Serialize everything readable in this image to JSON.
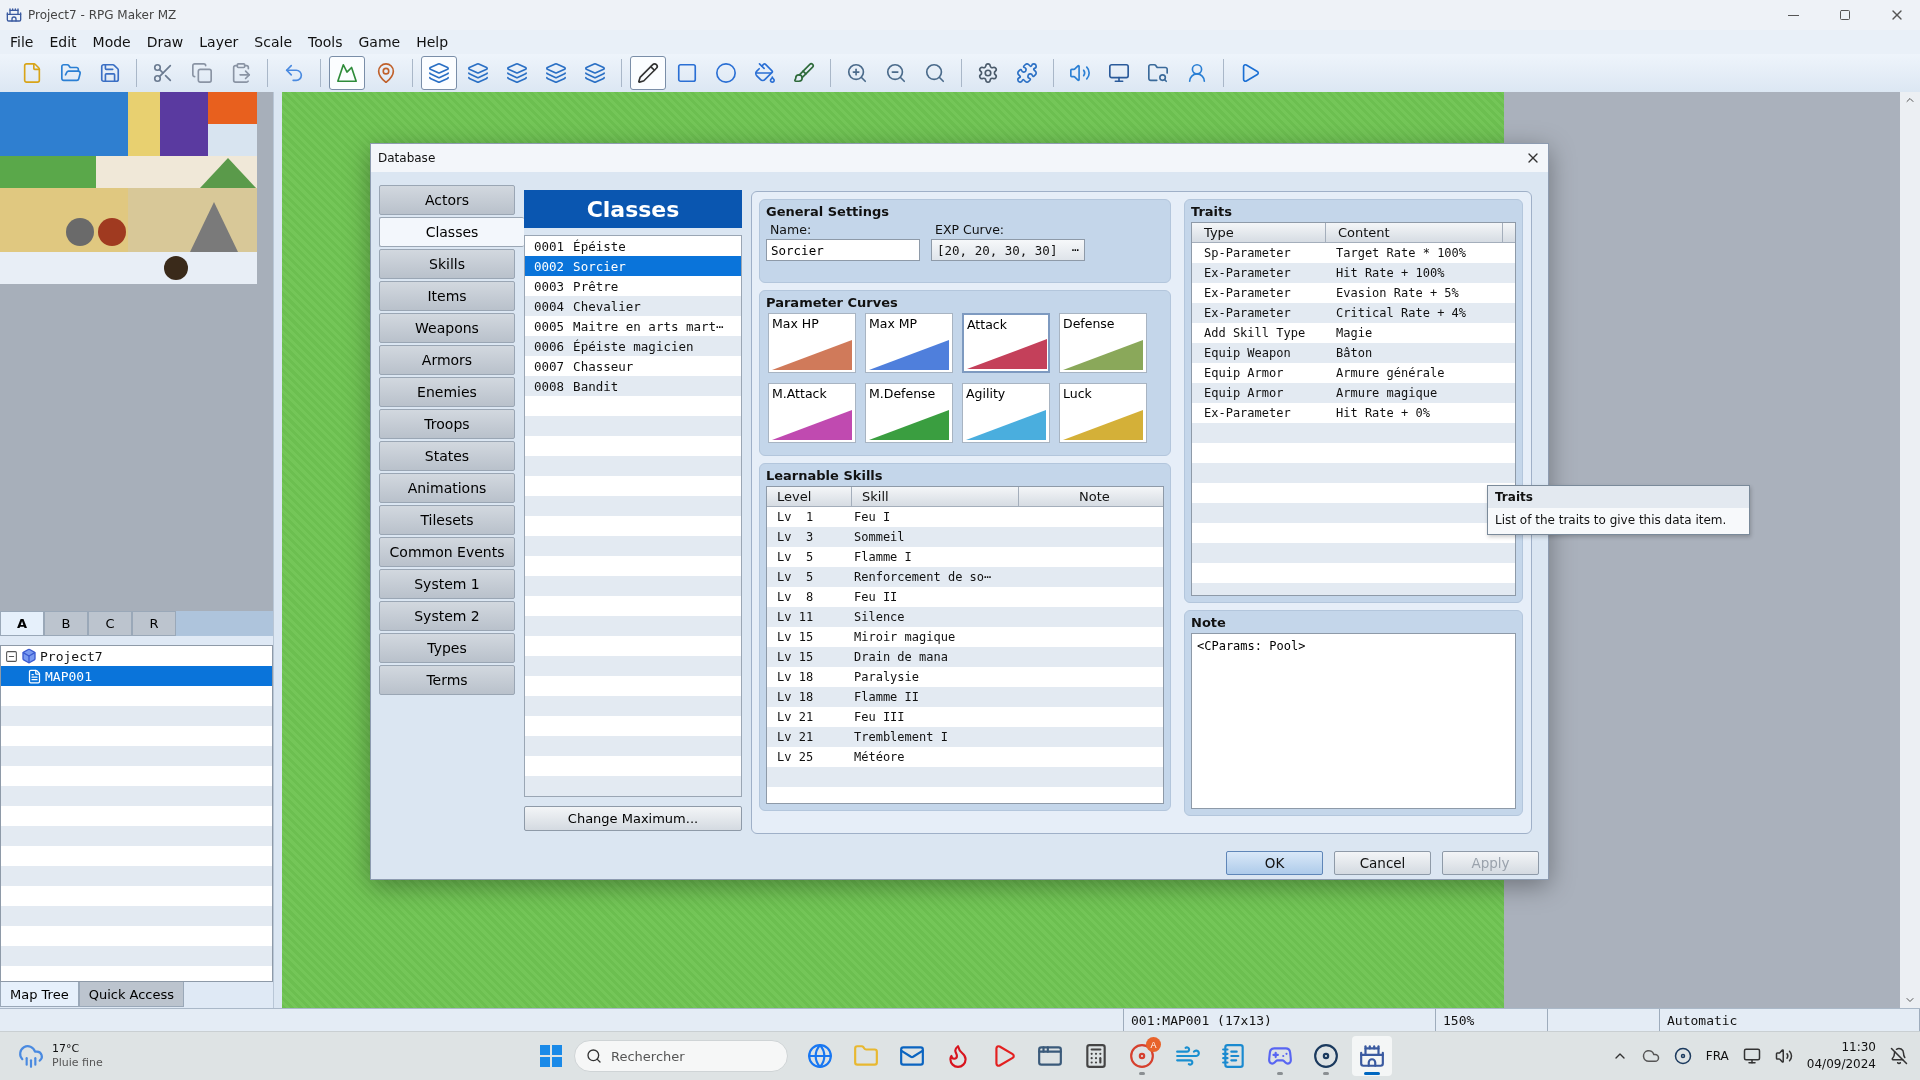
{
  "window": {
    "title": "Project7 - RPG Maker MZ"
  },
  "menu": [
    "File",
    "Edit",
    "Mode",
    "Draw",
    "Layer",
    "Scale",
    "Tools",
    "Game",
    "Help"
  ],
  "toolbar": [
    [
      {
        "kind": "new",
        "selected": false
      },
      {
        "kind": "open",
        "selected": false
      },
      {
        "kind": "save",
        "selected": false
      }
    ],
    [
      {
        "kind": "cut",
        "selected": false
      },
      {
        "kind": "copy",
        "selected": false
      },
      {
        "kind": "paste",
        "selected": false
      }
    ],
    [
      {
        "kind": "undo",
        "selected": false
      }
    ],
    [
      {
        "kind": "map",
        "selected": true
      },
      {
        "kind": "event",
        "selected": false
      }
    ],
    [
      {
        "kind": "layer",
        "selected": true
      },
      {
        "kind": "layer",
        "selected": false
      },
      {
        "kind": "layer",
        "selected": false
      },
      {
        "kind": "layer",
        "selected": false
      },
      {
        "kind": "layer",
        "selected": false
      }
    ],
    [
      {
        "kind": "pencil",
        "selected": true
      },
      {
        "kind": "rect",
        "selected": false
      },
      {
        "kind": "ellipse",
        "selected": false
      },
      {
        "kind": "fill",
        "selected": false
      },
      {
        "kind": "shadow",
        "selected": false
      }
    ],
    [
      {
        "kind": "zoomin",
        "selected": false
      },
      {
        "kind": "zoomout",
        "selected": false
      },
      {
        "kind": "zoomactual",
        "selected": false
      }
    ],
    [
      {
        "kind": "database",
        "selected": false
      },
      {
        "kind": "plugins",
        "selected": false
      }
    ],
    [
      {
        "kind": "sound",
        "selected": false
      },
      {
        "kind": "resources",
        "selected": false
      },
      {
        "kind": "search",
        "selected": false
      },
      {
        "kind": "generator",
        "selected": false
      }
    ],
    [
      {
        "kind": "playtest",
        "selected": false
      }
    ]
  ],
  "tileset": {
    "kind": "picture",
    "tabs": [
      {
        "label": "A",
        "selected": true
      },
      {
        "label": "B",
        "selected": false
      },
      {
        "label": "C",
        "selected": false
      },
      {
        "label": "R",
        "selected": false
      }
    ]
  },
  "map_tree": [
    {
      "label": "Project7",
      "selected": false,
      "expanded": true,
      "children": [
        {
          "label": "MAP001",
          "selected": true
        }
      ]
    }
  ],
  "panel_tabs": [
    {
      "label": "Map Tree",
      "selected": true
    },
    {
      "label": "Quick Access",
      "selected": false
    }
  ],
  "dialog": {
    "title": "Database",
    "categories": [
      {
        "label": "Actors",
        "selected": false
      },
      {
        "label": "Classes",
        "selected": true
      },
      {
        "label": "Skills",
        "selected": false
      },
      {
        "label": "Items",
        "selected": false
      },
      {
        "label": "Weapons",
        "selected": false
      },
      {
        "label": "Armors",
        "selected": false
      },
      {
        "label": "Enemies",
        "selected": false
      },
      {
        "label": "Troops",
        "selected": false
      },
      {
        "label": "States",
        "selected": false
      },
      {
        "label": "Animations",
        "selected": false
      },
      {
        "label": "Tilesets",
        "selected": false
      },
      {
        "label": "Common Events",
        "selected": false
      },
      {
        "label": "System 1",
        "selected": false
      },
      {
        "label": "System 2",
        "selected": false
      },
      {
        "label": "Types",
        "selected": false
      },
      {
        "label": "Terms",
        "selected": false
      }
    ],
    "list_title": "Classes",
    "items": [
      {
        "number": "0001",
        "name": "Épéiste",
        "selected": false
      },
      {
        "number": "0002",
        "name": "Sorcier",
        "selected": true
      },
      {
        "number": "0003",
        "name": "Prêtre",
        "selected": false
      },
      {
        "number": "0004",
        "name": "Chevalier",
        "selected": false
      },
      {
        "number": "0005",
        "name": "Maitre en arts mart⋯",
        "selected": false
      },
      {
        "number": "0006",
        "name": "Épéiste magicien",
        "selected": false
      },
      {
        "number": "0007",
        "name": "Chasseur",
        "selected": false
      },
      {
        "number": "0008",
        "name": "Bandit",
        "selected": false
      }
    ],
    "change_maximum": "Change Maximum...",
    "general_settings": {
      "title": "General Settings",
      "name_label": "Name:",
      "name_value": "Sorcier",
      "exp_label": "EXP Curve:",
      "exp_value": "[20, 20, 30, 30]",
      "exp_button": "⋯"
    },
    "parameter_curves": {
      "title": "Parameter Curves",
      "curves": [
        {
          "label": "Max HP",
          "color": "#d07a5a",
          "selected": false
        },
        {
          "label": "Max MP",
          "color": "#4f7fdc",
          "selected": false
        },
        {
          "label": "Attack",
          "color": "#c4405a",
          "selected": true
        },
        {
          "label": "Defense",
          "color": "#8aa85a",
          "selected": false
        },
        {
          "label": "M.Attack",
          "color": "#c04ab0",
          "selected": false
        },
        {
          "label": "M.Defense",
          "color": "#3a9e40",
          "selected": false
        },
        {
          "label": "Agility",
          "color": "#4aaede",
          "selected": false
        },
        {
          "label": "Luck",
          "color": "#d4b038",
          "selected": false
        }
      ]
    },
    "learnable_skills": {
      "title": "Learnable Skills",
      "columns": [
        "Level",
        "Skill",
        "Note"
      ],
      "rows": [
        {
          "level": "Lv  1",
          "skill": "Feu I"
        },
        {
          "level": "Lv  3",
          "skill": "Sommeil"
        },
        {
          "level": "Lv  5",
          "skill": "Flamme I"
        },
        {
          "level": "Lv  5",
          "skill": "Renforcement de so⋯"
        },
        {
          "level": "Lv  8",
          "skill": "Feu II"
        },
        {
          "level": "Lv 11",
          "skill": "Silence"
        },
        {
          "level": "Lv 15",
          "skill": "Miroir magique"
        },
        {
          "level": "Lv 15",
          "skill": "Drain de mana"
        },
        {
          "level": "Lv 18",
          "skill": "Paralysie"
        },
        {
          "level": "Lv 18",
          "skill": "Flamme II"
        },
        {
          "level": "Lv 21",
          "skill": "Feu III"
        },
        {
          "level": "Lv 21",
          "skill": "Tremblement I"
        },
        {
          "level": "Lv 25",
          "skill": "Météore"
        }
      ]
    },
    "traits": {
      "title": "Traits",
      "columns": [
        "Type",
        "Content"
      ],
      "rows": [
        {
          "type": "Sp-Parameter",
          "content": "Target Rate * 100%"
        },
        {
          "type": "Ex-Parameter",
          "content": "Hit Rate + 100%"
        },
        {
          "type": "Ex-Parameter",
          "content": "Evasion Rate + 5%"
        },
        {
          "type": "Ex-Parameter",
          "content": "Critical Rate + 4%"
        },
        {
          "type": "Add Skill Type",
          "content": "Magie"
        },
        {
          "type": "Equip Weapon",
          "content": "Bâton"
        },
        {
          "type": "Equip Armor",
          "content": "Armure générale"
        },
        {
          "type": "Equip Armor",
          "content": "Armure magique"
        },
        {
          "type": "Ex-Parameter",
          "content": "Hit Rate + 0%"
        }
      ]
    },
    "note": {
      "title": "Note",
      "value": "<CParams: Pool>"
    },
    "buttons": [
      {
        "label": "OK",
        "kind": "default",
        "disabled": false
      },
      {
        "label": "Cancel",
        "kind": "normal",
        "disabled": false
      },
      {
        "label": "Apply",
        "kind": "normal",
        "disabled": true
      }
    ],
    "tooltip": {
      "title": "Traits",
      "text": "List of the traits to give this data item."
    }
  },
  "status_bar": {
    "map": "001:MAP001 (17x13)",
    "zoom": "150%",
    "mode": "Automatic"
  },
  "taskbar": {
    "weather": {
      "temperature": "17°C",
      "condition": "Pluie fine"
    },
    "search_placeholder": "Rechercher",
    "apps": [
      {
        "kind": "facebook",
        "running": false,
        "selected": false
      },
      {
        "kind": "explorer",
        "running": false,
        "selected": false
      },
      {
        "kind": "mail",
        "running": false,
        "selected": false
      },
      {
        "kind": "ribbon",
        "running": false,
        "selected": false
      },
      {
        "kind": "video",
        "running": false,
        "selected": false
      },
      {
        "kind": "window",
        "running": false,
        "selected": false
      },
      {
        "kind": "calculator",
        "running": false,
        "selected": false
      },
      {
        "kind": "chrome",
        "running": true,
        "selected": false,
        "badge": "A"
      },
      {
        "kind": "edge",
        "running": false,
        "selected": false
      },
      {
        "kind": "notepad",
        "running": false,
        "selected": false
      },
      {
        "kind": "discord",
        "running": true,
        "selected": false
      },
      {
        "kind": "steam",
        "running": true,
        "selected": false
      },
      {
        "kind": "castle",
        "running": true,
        "selected": true
      }
    ],
    "language": "FRA",
    "time": "11:30",
    "date": "04/09/2024"
  }
}
